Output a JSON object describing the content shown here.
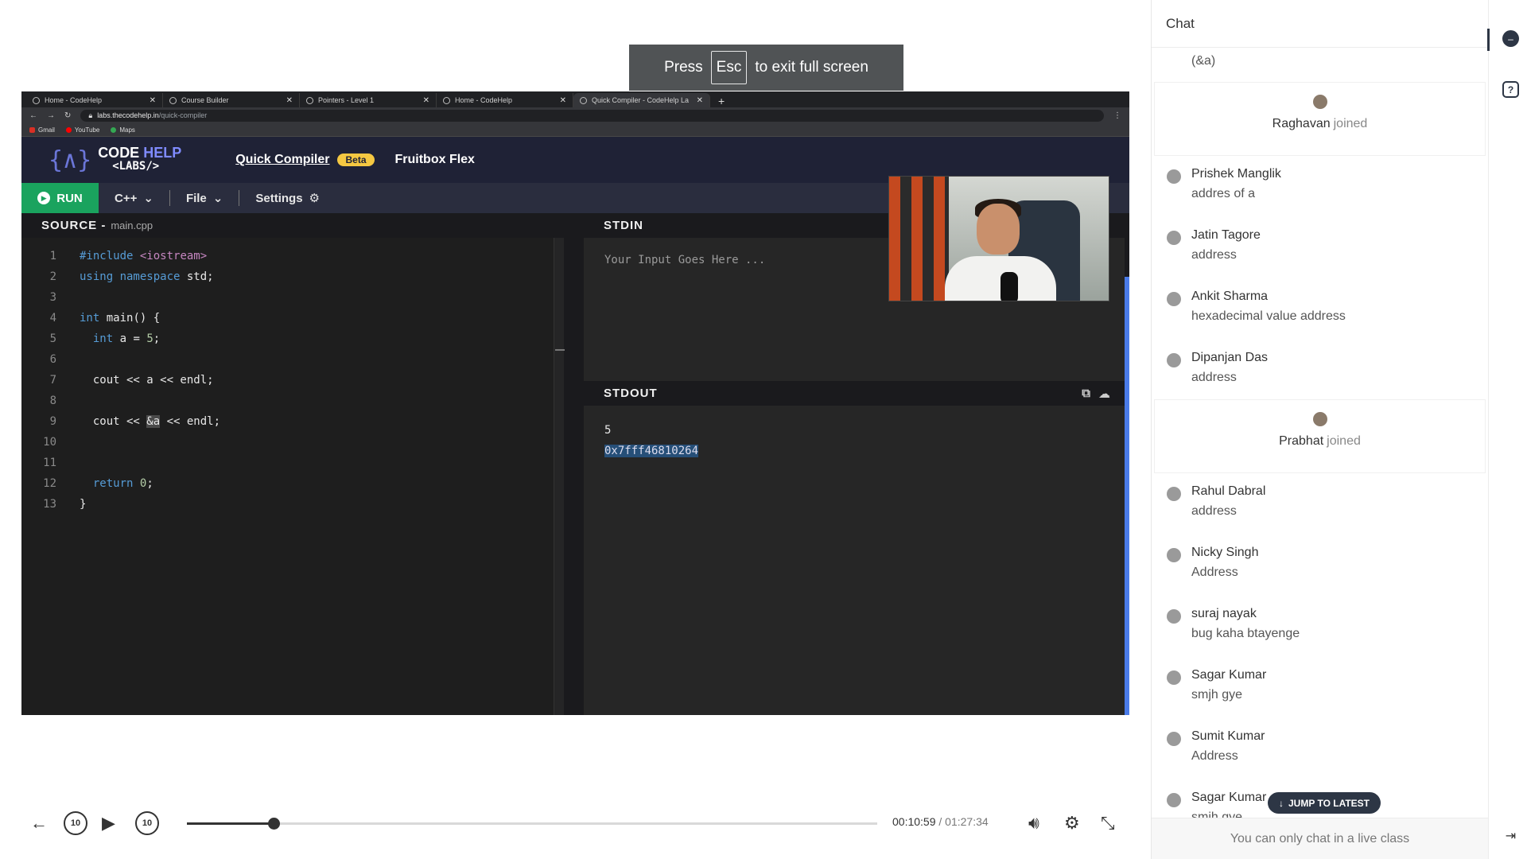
{
  "fullscreen_notice": {
    "press": "Press",
    "key": "Esc",
    "rest": "to exit full screen"
  },
  "browser": {
    "tabs": [
      {
        "label": "Home - CodeHelp"
      },
      {
        "label": "Course Builder"
      },
      {
        "label": "Pointers - Level 1"
      },
      {
        "label": "Home - CodeHelp"
      },
      {
        "label": "Quick Compiler - CodeHelp La"
      }
    ],
    "url_host": "labs.thecodehelp.in",
    "url_path": "/quick-compiler",
    "bookmarks": [
      {
        "label": "Gmail"
      },
      {
        "label": "YouTube"
      },
      {
        "label": "Maps"
      }
    ]
  },
  "site": {
    "logo_code": "CODE",
    "logo_help": "HELP",
    "logo_labs": "<LABS/>",
    "nav_quick_compiler": "Quick Compiler",
    "nav_beta": "Beta",
    "nav_fruitbox": "Fruitbox Flex"
  },
  "toolbar": {
    "run": "RUN",
    "language": "C++",
    "file": "File",
    "settings": "Settings"
  },
  "source": {
    "title": "SOURCE -",
    "filename": "main.cpp",
    "lines": [
      "1",
      "2",
      "3",
      "4",
      "5",
      "6",
      "7",
      "8",
      "9",
      "10",
      "11",
      "12",
      "13"
    ]
  },
  "stdin": {
    "title": "STDIN",
    "placeholder": "Your Input Goes Here ..."
  },
  "stdout": {
    "title": "STDOUT",
    "lines": [
      "5",
      "0x7fff46810264"
    ]
  },
  "player": {
    "current_time": "00:10:59",
    "separator": "/",
    "duration": "01:27:34",
    "skip_back": "10",
    "skip_forward": "10",
    "progress_fraction": 0.1254
  },
  "chat": {
    "title": "Chat",
    "partial_message": "(&a)",
    "entries": [
      {
        "type": "join",
        "name": "Raghavan",
        "label": "joined"
      },
      {
        "type": "msg",
        "name": "Prishek Manglik",
        "text": "addres of a"
      },
      {
        "type": "msg",
        "name": "Jatin Tagore",
        "text": "address"
      },
      {
        "type": "msg",
        "name": "Ankit Sharma",
        "text": "hexadecimal value address"
      },
      {
        "type": "msg",
        "name": "Dipanjan Das",
        "text": "address"
      },
      {
        "type": "join",
        "name": "Prabhat",
        "label": "joined"
      },
      {
        "type": "msg",
        "name": "Rahul Dabral",
        "text": "address"
      },
      {
        "type": "msg",
        "name": "Nicky Singh",
        "text": "Address"
      },
      {
        "type": "msg",
        "name": "suraj nayak",
        "text": "bug kaha btayenge"
      },
      {
        "type": "msg",
        "name": "Sagar Kumar",
        "text": "smjh gye"
      },
      {
        "type": "msg",
        "name": "Sumit Kumar",
        "text": "Address"
      },
      {
        "type": "msg",
        "name": "Sagar Kumar",
        "text": "smjh gye"
      }
    ],
    "jump_to_latest": "JUMP TO LATEST",
    "footer": "You can only chat in a live class"
  },
  "colors": {
    "run_green": "#1aa35e",
    "accent_dark": "#2d3645",
    "beta_yellow": "#f5c842"
  }
}
